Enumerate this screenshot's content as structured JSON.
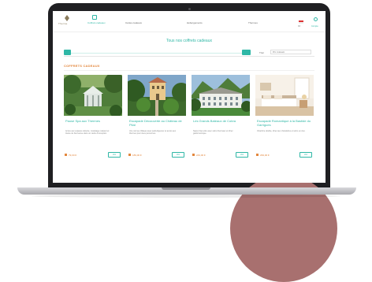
{
  "brand": {
    "name": "Therme",
    "colors": {
      "accent": "#2fb7a6",
      "orange": "#e3873d",
      "frame": "#1f1f22",
      "circle": "#a8706f"
    }
  },
  "nav": {
    "items": [
      {
        "label": "Coffrets cadeaux",
        "active": true
      },
      {
        "label": "Cartes cadeaux",
        "active": false
      },
      {
        "label": "Hébergements",
        "active": false
      },
      {
        "label": "Thermes",
        "active": false
      }
    ],
    "lang": "FR",
    "account": "Compte"
  },
  "hero": {
    "title": "Tous nos coffrets cadeaux"
  },
  "filters": {
    "sort_label": "Trier",
    "sort_value": "Prix croissant"
  },
  "section": {
    "title": "COFFRETS CADEAUX"
  },
  "cards": [
    {
      "title": "Pause Spa aux Thermes",
      "description": "Accès aux espaces détente, modelage relaxant et tisane de bienvenue dans un cadre d'exception.",
      "price": "79,00 €",
      "button": "Voir",
      "image": "gazebo-garden"
    },
    {
      "title": "Escapade Découverte au Château de Pilat",
      "description": "Une nuit au château avec petit-déjeuner et accès aux thermes pour deux personnes.",
      "price": "189,00 €",
      "button": "Voir",
      "image": "chateau-garden"
    },
    {
      "title": "Les Grands Bateaux de Cobra",
      "description": "Séjour bien-être avec soins thermaux et dîner gastronomique.",
      "price": "249,00 €",
      "button": "Voir",
      "image": "hotel-mountain"
    },
    {
      "title": "Escapade Romantique à la Bastide du Garrigues",
      "description": "Chambre double, dîner aux chandelles et soins en duo.",
      "price": "299,00 €",
      "button": "Voir",
      "image": "bedroom-interior"
    }
  ]
}
